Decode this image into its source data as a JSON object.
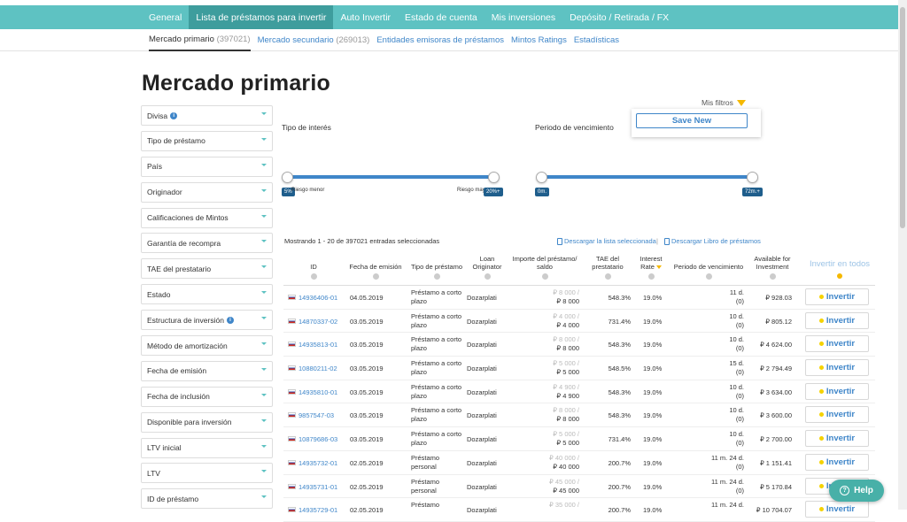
{
  "nav": {
    "tabs": [
      {
        "label": "General"
      },
      {
        "label": "Lista de préstamos para invertir"
      },
      {
        "label": "Auto Invertir"
      },
      {
        "label": "Estado de cuenta"
      },
      {
        "label": "Mis inversiones"
      },
      {
        "label": "Depósito / Retirada / FX"
      }
    ],
    "active_index": 1
  },
  "subnav": {
    "items": [
      {
        "label": "Mercado primario",
        "count": "(397021)"
      },
      {
        "label": "Mercado secundario",
        "count": "(269013)"
      },
      {
        "label": "Entidades emisoras de préstamos",
        "count": ""
      },
      {
        "label": "Mintos Ratings",
        "count": ""
      },
      {
        "label": "Estadísticas",
        "count": ""
      }
    ]
  },
  "page": {
    "title": "Mercado primario"
  },
  "filters": [
    {
      "label": "Divisa"
    },
    {
      "label": "Tipo de préstamo"
    },
    {
      "label": "País"
    },
    {
      "label": "Originador"
    },
    {
      "label": "Calificaciones de Mintos"
    },
    {
      "label": "Garantía de recompra"
    },
    {
      "label": "TAE del prestatario"
    },
    {
      "label": "Estado"
    },
    {
      "label": "Estructura de inversión"
    },
    {
      "label": "Método de amortización"
    },
    {
      "label": "Fecha de emisión"
    },
    {
      "label": "Fecha de inclusión"
    },
    {
      "label": "Disponible para inversión"
    },
    {
      "label": "LTV inicial"
    },
    {
      "label": "LTV"
    },
    {
      "label": "ID de préstamo"
    }
  ],
  "myfilters": {
    "label": "Mis filtros",
    "save_new": "Save New"
  },
  "interest_slider": {
    "label": "Tipo de interés",
    "min_tag": "5%",
    "max_tag": "20%+",
    "min_label": "Riesgo menor",
    "max_label": "Riesgo mayor"
  },
  "term_slider": {
    "label": "Periodo de vencimiento",
    "min_tag": "0m.",
    "max_tag": "72m.+"
  },
  "table": {
    "showing": "Mostrando 1 - 20 de 397021 entradas seleccionadas",
    "download_selected": "Descargar la lista seleccionada",
    "download_book": "Descargar Libro de préstamos",
    "headers": {
      "id": "ID",
      "date": "Fecha de emisión",
      "type": "Tipo de préstamo",
      "orig": "Loan Originator",
      "amount": "Importe del préstamo/ saldo",
      "tae": "TAE del prestatario",
      "rate": "Interest Rate",
      "term": "Periodo de vencimiento",
      "avail": "Available for Investment",
      "invest_all": "Invertir en todos"
    },
    "invest_label": "Invertir",
    "rows": [
      {
        "id": "14936406-01",
        "date": "04.05.2019",
        "type": "Préstamo a corto plazo",
        "orig": "Dozarplati",
        "amount": "₽ 8 000 /",
        "balance": "₽ 8 000",
        "tae": "548.3%",
        "rate": "19.0%",
        "term": "11 d.",
        "term_sub": "(0)",
        "avail": "₽ 928.03"
      },
      {
        "id": "14870337-02",
        "date": "03.05.2019",
        "type": "Préstamo a corto plazo",
        "orig": "Dozarplati",
        "amount": "₽ 4 000 /",
        "balance": "₽ 4 000",
        "tae": "731.4%",
        "rate": "19.0%",
        "term": "10 d.",
        "term_sub": "(0)",
        "avail": "₽ 805.12"
      },
      {
        "id": "14935813-01",
        "date": "03.05.2019",
        "type": "Préstamo a corto plazo",
        "orig": "Dozarplati",
        "amount": "₽ 8 000 /",
        "balance": "₽ 8 000",
        "tae": "548.3%",
        "rate": "19.0%",
        "term": "10 d.",
        "term_sub": "(0)",
        "avail": "₽ 4 624.00"
      },
      {
        "id": "10880211-02",
        "date": "03.05.2019",
        "type": "Préstamo a corto plazo",
        "orig": "Dozarplati",
        "amount": "₽ 5 000 /",
        "balance": "₽ 5 000",
        "tae": "548.5%",
        "rate": "19.0%",
        "term": "15 d.",
        "term_sub": "(0)",
        "avail": "₽ 2 794.49"
      },
      {
        "id": "14935810-01",
        "date": "03.05.2019",
        "type": "Préstamo a corto plazo",
        "orig": "Dozarplati",
        "amount": "₽ 4 900 /",
        "balance": "₽ 4 900",
        "tae": "548.3%",
        "rate": "19.0%",
        "term": "10 d.",
        "term_sub": "(0)",
        "avail": "₽ 3 634.00"
      },
      {
        "id": "9857547-03",
        "date": "03.05.2019",
        "type": "Préstamo a corto plazo",
        "orig": "Dozarplati",
        "amount": "₽ 8 000 /",
        "balance": "₽ 8 000",
        "tae": "548.3%",
        "rate": "19.0%",
        "term": "10 d.",
        "term_sub": "(0)",
        "avail": "₽ 3 600.00"
      },
      {
        "id": "10879686-03",
        "date": "03.05.2019",
        "type": "Préstamo a corto plazo",
        "orig": "Dozarplati",
        "amount": "₽ 5 000 /",
        "balance": "₽ 5 000",
        "tae": "731.4%",
        "rate": "19.0%",
        "term": "10 d.",
        "term_sub": "(0)",
        "avail": "₽ 2 700.00"
      },
      {
        "id": "14935732-01",
        "date": "02.05.2019",
        "type": "Préstamo personal",
        "orig": "Dozarplati",
        "amount": "₽ 40 000 /",
        "balance": "₽ 40 000",
        "tae": "200.7%",
        "rate": "19.0%",
        "term": "11 m. 24 d.",
        "term_sub": "(0)",
        "avail": "₽ 1 151.41"
      },
      {
        "id": "14935731-01",
        "date": "02.05.2019",
        "type": "Préstamo personal",
        "orig": "Dozarplati",
        "amount": "₽ 45 000 /",
        "balance": "₽ 45 000",
        "tae": "200.7%",
        "rate": "19.0%",
        "term": "11 m. 24 d.",
        "term_sub": "(0)",
        "avail": "₽ 5 170.84"
      },
      {
        "id": "14935729-01",
        "date": "02.05.2019",
        "type": "Préstamo",
        "orig": "Dozarplati",
        "amount": "₽ 35 000 /",
        "balance": "",
        "tae": "200.7%",
        "rate": "19.0%",
        "term": "11 m. 24 d.",
        "term_sub": "",
        "avail": "₽ 10 704.07"
      }
    ]
  },
  "help": {
    "label": "Help"
  },
  "colors": {
    "nav_bg": "#5ec2c2",
    "nav_active": "#3e9d9d",
    "link": "#3f86c9",
    "accent": "#f5b800",
    "help_bg": "#48b0a8"
  }
}
